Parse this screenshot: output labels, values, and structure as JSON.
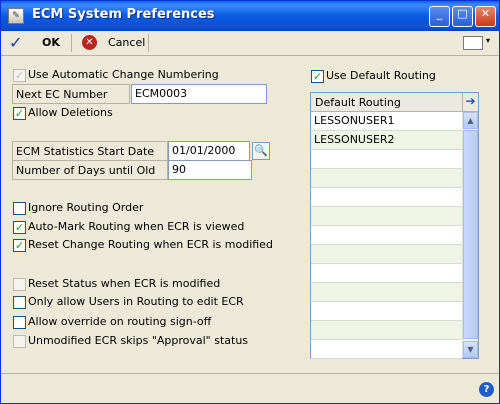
{
  "window": {
    "title": "ECM System Preferences",
    "app_icon_glyph": "✎",
    "minimize_glyph": "_",
    "maximize_glyph": "□",
    "close_glyph": "✕"
  },
  "toolbar": {
    "ok_icon": "checkmark-icon",
    "ok_glyph": "✓",
    "ok_label": "OK",
    "cancel_icon": "cancel-x-icon",
    "cancel_glyph": "✕",
    "cancel_label": "Cancel",
    "menu_arrow_glyph": "▾"
  },
  "options": {
    "auto_change_numbering": {
      "label": "Use Automatic Change Numbering",
      "checked": true,
      "enabled": false
    },
    "next_ec_number": {
      "label": "Next EC Number",
      "value": "ECM0003"
    },
    "allow_deletions": {
      "label": "Allow Deletions",
      "checked": true,
      "enabled": true
    },
    "stats_start_date": {
      "label": "ECM Statistics Start Date",
      "value": "01/01/2000"
    },
    "days_until_old": {
      "label": "Number of Days until Old",
      "value": "90"
    },
    "ignore_routing_order": {
      "label": "Ignore Routing Order",
      "checked": false,
      "enabled": true
    },
    "auto_mark_routing": {
      "label": "Auto-Mark Routing when ECR is viewed",
      "checked": true,
      "enabled": true
    },
    "reset_change_routing": {
      "label": "Reset Change Routing when ECR is modified",
      "checked": true,
      "enabled": true
    },
    "reset_status": {
      "label": "Reset Status when ECR is modified",
      "checked": false,
      "enabled": false
    },
    "only_routing_users_edit": {
      "label": "Only allow Users in Routing to edit ECR",
      "checked": false,
      "enabled": true
    },
    "allow_override_signoff": {
      "label": "Allow override on routing sign-off",
      "checked": false,
      "enabled": true
    },
    "unmodified_skips_approval": {
      "label": "Unmodified ECR skips \"Approval\" status",
      "checked": false,
      "enabled": false
    }
  },
  "routing": {
    "use_default_routing": {
      "label": "Use Default Routing",
      "checked": true
    },
    "column_header": "Default Routing",
    "header_button_glyph": "➔",
    "rows": [
      "LESSONUSER1",
      "LESSONUSER2",
      "",
      "",
      "",
      "",
      "",
      "",
      "",
      "",
      "",
      "",
      ""
    ],
    "scroll_up_glyph": "▲",
    "scroll_down_glyph": "▼"
  },
  "status": {
    "help_glyph": "?"
  }
}
